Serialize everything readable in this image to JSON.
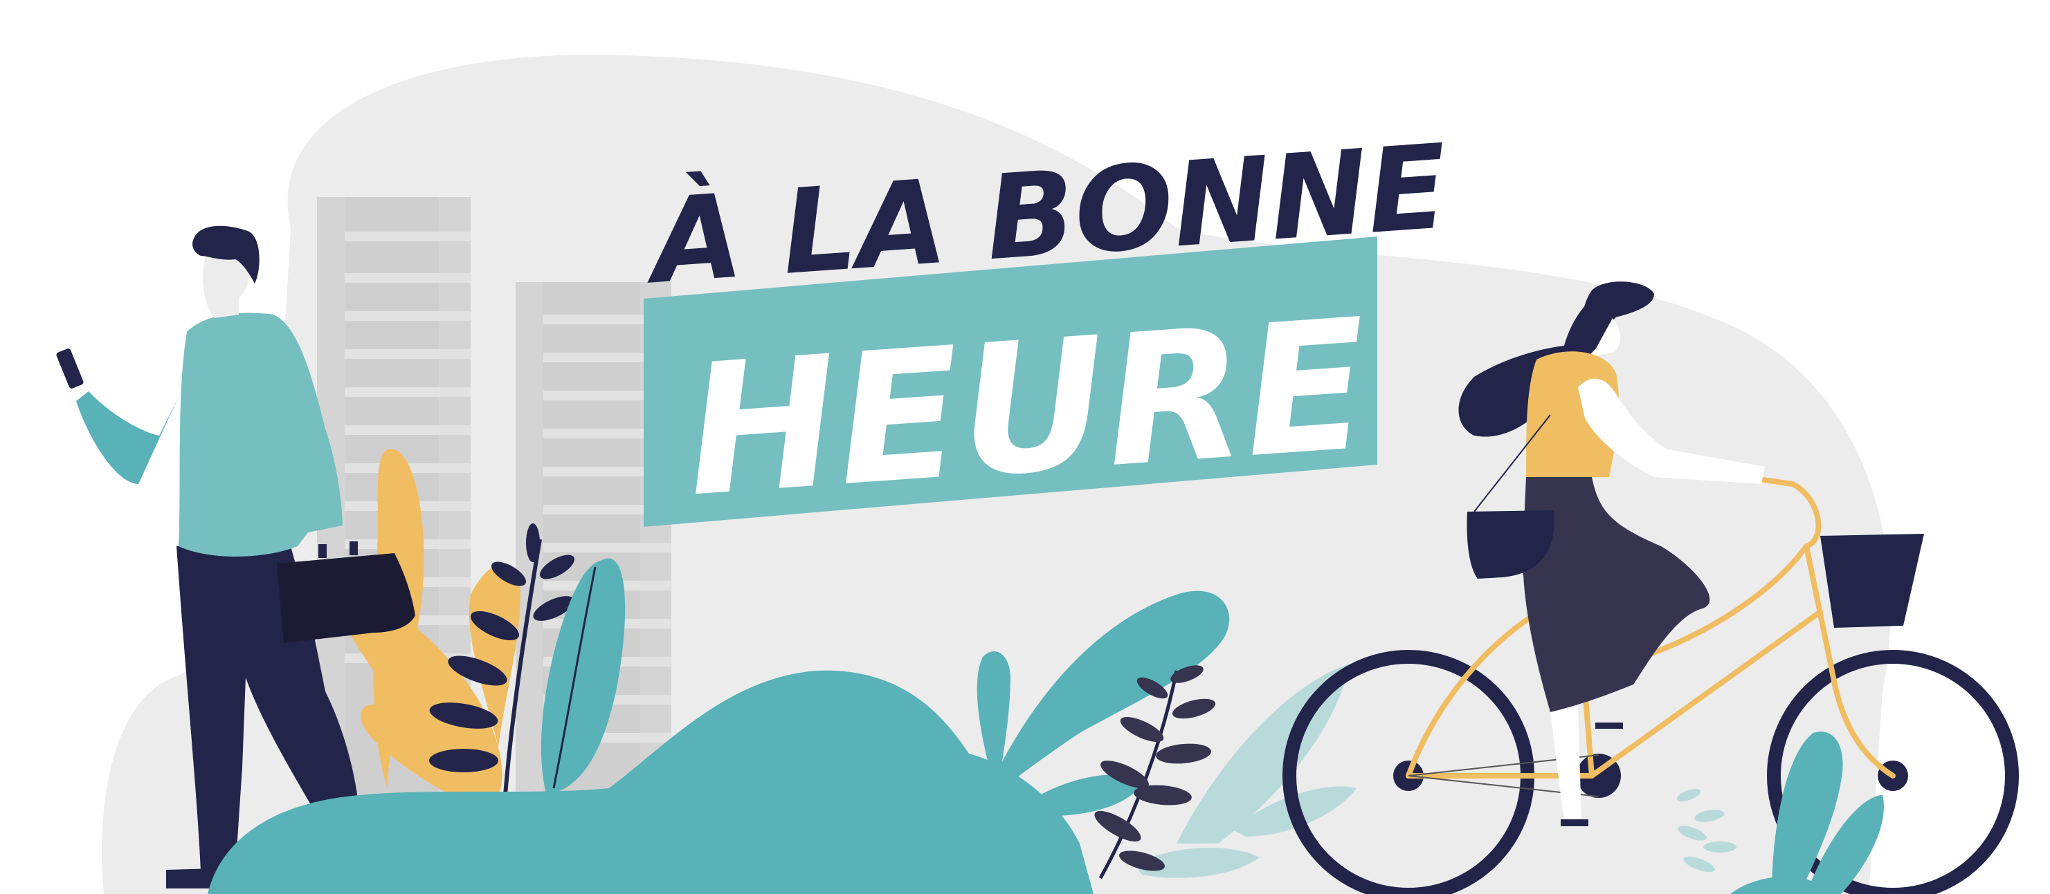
{
  "title": {
    "line1": "À LA BONNE",
    "line2": "HEURE"
  },
  "colors": {
    "navy": "#22244a",
    "teal": "#58b2b8",
    "teal_banner": "#76bfc0",
    "yellow": "#f0bd62",
    "light_gray": "#ececec",
    "building_gray": "#d8d8d8",
    "skin": "#ffffff",
    "dark_skirt": "#36344f"
  },
  "illustration": {
    "figures": [
      "man-with-phone-and-briefcase",
      "woman-on-bicycle"
    ],
    "elements": [
      "buildings",
      "foliage",
      "bicycle-basket"
    ]
  }
}
